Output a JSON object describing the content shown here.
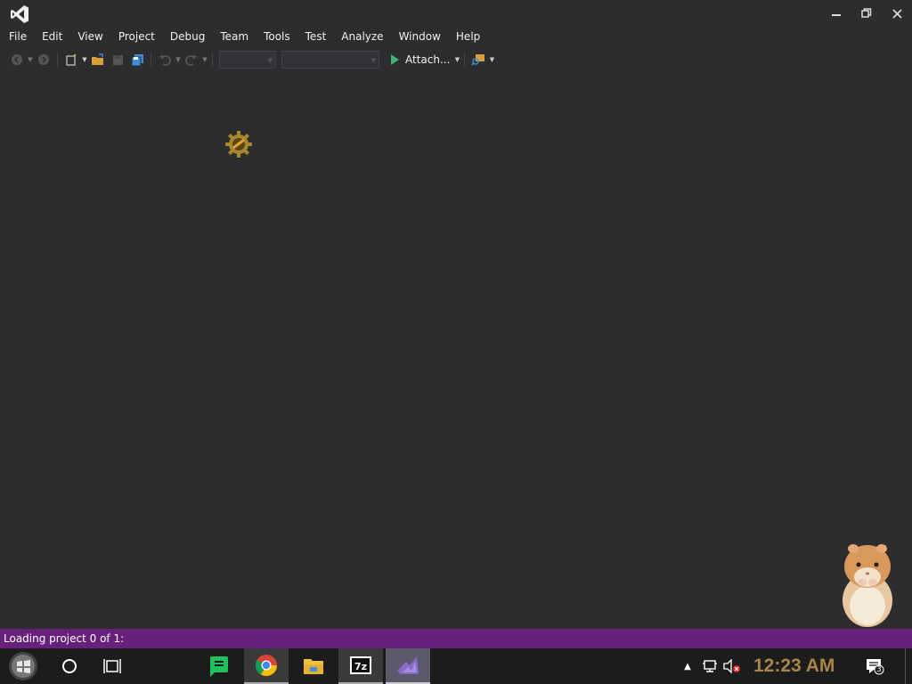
{
  "window": {
    "logo_icon": "visual-studio-logo-icon",
    "minimize_icon": "minimize-icon",
    "restore_icon": "restore-icon",
    "close_icon": "close-icon"
  },
  "menu": {
    "items": [
      "File",
      "Edit",
      "View",
      "Project",
      "Debug",
      "Team",
      "Tools",
      "Test",
      "Analyze",
      "Window",
      "Help"
    ]
  },
  "toolbar": {
    "run_label": "Attach...",
    "config_value": "",
    "platform_value": ""
  },
  "status": {
    "text": "Loading project 0 of 1:"
  },
  "taskbar": {
    "clock": "12:23 AM",
    "notification_count": "3"
  },
  "colors": {
    "background": "#2d2d30",
    "statusbar": "#68217a",
    "taskbar": "#1c1c1c",
    "clock": "#a7864a",
    "run": "#3cb371"
  }
}
